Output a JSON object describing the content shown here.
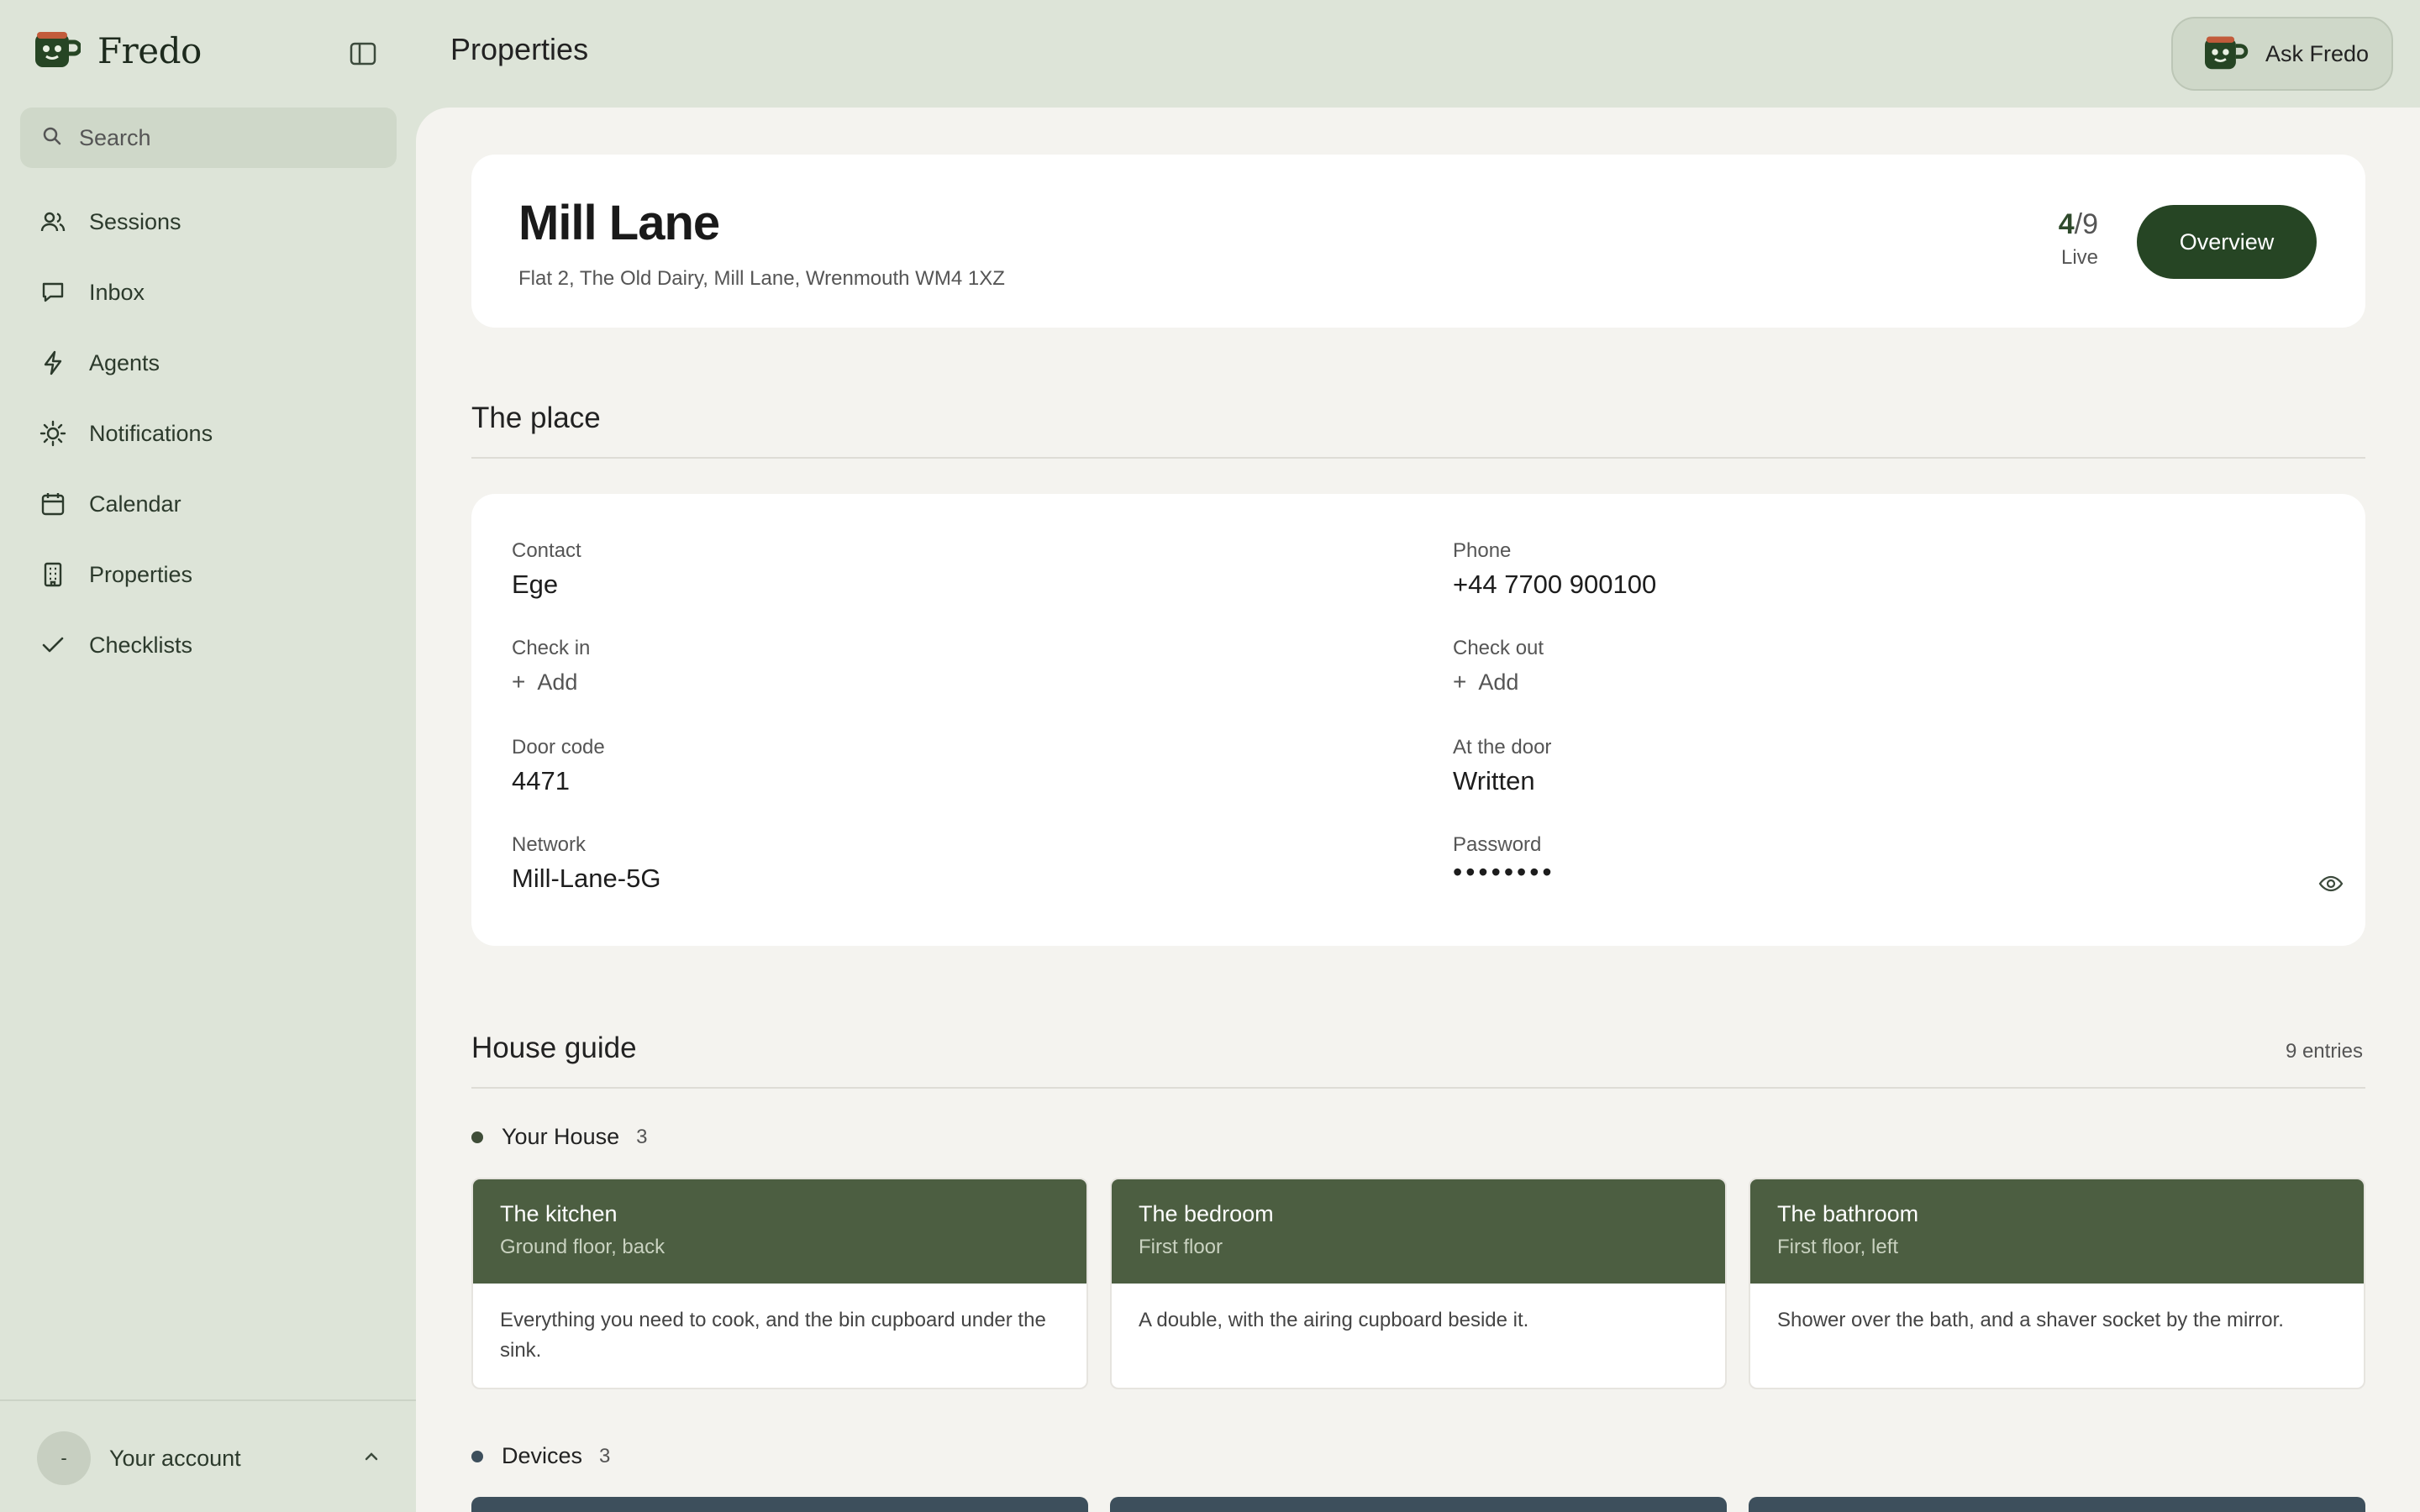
{
  "app": {
    "name": "Fredo",
    "logo_icon": "mug-face-icon"
  },
  "sidebar": {
    "search_placeholder": "Search",
    "items": [
      {
        "label": "Sessions",
        "icon": "users-icon"
      },
      {
        "label": "Inbox",
        "icon": "chat-icon"
      },
      {
        "label": "Agents",
        "icon": "bolt-icon"
      },
      {
        "label": "Notifications",
        "icon": "sun-icon"
      },
      {
        "label": "Calendar",
        "icon": "calendar-icon"
      },
      {
        "label": "Properties",
        "icon": "building-icon"
      },
      {
        "label": "Checklists",
        "icon": "check-icon"
      }
    ],
    "account": {
      "avatar_text": "-",
      "label": "Your account"
    }
  },
  "topbar": {
    "title": "Properties",
    "ask_button": "Ask Fredo"
  },
  "property": {
    "name": "Mill Lane",
    "address": "Flat 2, The Old Dairy, Mill Lane, Wrenmouth WM4 1XZ",
    "live_done": "4",
    "live_total": "/9",
    "live_label": "Live",
    "overview_button": "Overview"
  },
  "place": {
    "title": "The place",
    "contact": {
      "label": "Contact",
      "value": "Ege"
    },
    "phone": {
      "label": "Phone",
      "value": "+44 7700 900100"
    },
    "check_in": {
      "label": "Check in",
      "action": "Add"
    },
    "check_out": {
      "label": "Check out",
      "action": "Add"
    },
    "door_code": {
      "label": "Door code",
      "value": "4471"
    },
    "at_the_door": {
      "label": "At the door",
      "value": "Written"
    },
    "network": {
      "label": "Network",
      "value": "Mill-Lane-5G"
    },
    "password": {
      "label": "Password",
      "value": "••••••••"
    }
  },
  "guide": {
    "title": "House guide",
    "entries": "9 entries",
    "groups": [
      {
        "name": "Your House",
        "count": "3",
        "color": "#3f4d38",
        "cards": [
          {
            "title": "The kitchen",
            "subtitle": "Ground floor, back",
            "body": "Everything you need to cook, and the bin cupboard under the sink."
          },
          {
            "title": "The bedroom",
            "subtitle": "First floor",
            "body": "A double, with the airing cupboard beside it."
          },
          {
            "title": "The bathroom",
            "subtitle": "First floor, left",
            "body": "Shower over the bath, and a shaver socket by the mirror."
          }
        ]
      },
      {
        "name": "Devices",
        "count": "3",
        "color": "#3d4f5c"
      }
    ]
  },
  "colors": {
    "accent": "#264524",
    "sidebar_bg": "#dde4d8",
    "card_header": "#4c5e41",
    "device_header": "#3d4f5c"
  }
}
